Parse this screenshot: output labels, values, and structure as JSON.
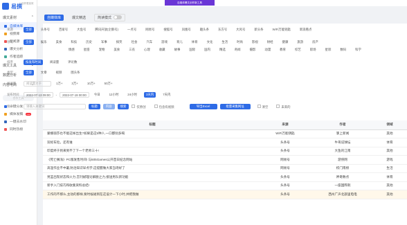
{
  "app": {
    "name": "易撰",
    "subtitle": "让创作更高效"
  },
  "top_ad": "自媒体爆文创作新工具",
  "sidebar": {
    "sections": [
      {
        "label": "爆文素材",
        "items": [
          "自媒体库",
          "视频库",
          "新闻源",
          "爆文分析",
          "作者追踪"
        ]
      },
      {
        "label": "爆文工具",
        "items": [
          "数据分析"
        ]
      },
      {
        "label": "内容电商",
        "items": []
      }
    ],
    "group": "合作工具",
    "tools": [
      "一键分发",
      "媒体发稿",
      "一键去水印",
      "同时热榜"
    ],
    "new_badge": "new"
  },
  "tabs": [
    "自媒体库",
    "爆文精选",
    "简读模式"
  ],
  "filters": {
    "source": {
      "label": "来源",
      "items": [
        "全部",
        "头条号",
        "百家号",
        "大鱼号",
        "腾讯开放(企鹅号)",
        "一点号",
        "网易号",
        "搜狐号",
        "凤凰号",
        "趣头条",
        "东方号",
        "大风号",
        "新头条",
        "WiFi万能钥匙",
        "新浪看点"
      ]
    },
    "field": {
      "label": "领域",
      "row1": [
        "全部",
        "娱乐",
        "美食",
        "科技",
        "历史",
        "军事",
        "搞笑",
        "社会",
        "汽车",
        "游戏",
        "育儿",
        "体育",
        "文化",
        "生活",
        "时尚",
        "影视",
        "财经",
        "健康",
        "旅游",
        "房产"
      ],
      "row2": [
        "情感",
        "星座",
        "宠物",
        "美食",
        "三农",
        "心理",
        "收藏",
        "故事",
        "国际",
        "国内",
        "精选",
        "奇闻",
        "摄影",
        "动漫",
        "教育",
        "综艺",
        "职场",
        "星际",
        "数码",
        "科学"
      ]
    },
    "sort": {
      "label": "排序",
      "items": [
        "按发布时间",
        "阅读量",
        "评论数"
      ]
    },
    "type": {
      "label": "类型",
      "items": [
        "全部",
        "文章",
        "视频",
        "图头条"
      ]
    },
    "read": {
      "label": "阅读量",
      "placeholder": "阅读量大于",
      "items": [
        "1万+",
        "3万+",
        "10万+",
        "50万+"
      ]
    },
    "time": {
      "label": "发布时间",
      "start": "2022-07-13 09:00",
      "end": "2022-07-19 00:00",
      "items": [
        "今日",
        "12小时",
        "24小时",
        "3天内",
        "7天内"
      ]
    },
    "search": {
      "label": "搜索",
      "placeholder": "请输入关键词",
      "btn_title": "标题",
      "btn_content": "内容",
      "btn_search": "搜索",
      "only_original": "仅原创",
      "exclude_video": "包含有视频",
      "export": "导出Excel",
      "batch": "批量采集网址",
      "clear": "清空",
      "word_cloud": "未来的"
    }
  },
  "table": {
    "headers": [
      "标题",
      "来源",
      "作者",
      "领域"
    ],
    "rows": [
      [
        "蒙娜丽莎也不能这样出生?如果是这5种人,一口都别多喝",
        "WiFi万能钥匙",
        "掌上新闻",
        "其他"
      ],
      [
        "双标车险，还有谁",
        "头条号",
        "牛哥说球坛",
        "体育"
      ],
      [
        "印度终于到来到不了下一个老师三十!",
        "头条号",
        "大鱼的江南",
        "其他"
      ],
      [
        "《死亡搁浅》PC版发售时间! 与505Games公开首日纪念网站",
        "网易号",
        "游侠网",
        "游戏"
      ],
      [
        "高温作业不中暑,防治知识早点学,这提醒做大家当场好了",
        "网易号",
        "校门南榜",
        "生活"
      ],
      [
        "男篮出现状态和火力,宫刊斌理论解脱之力,接送男队新功能",
        "头条号",
        "神奇数点",
        "体育"
      ],
      [
        "新手入门技巧和收集资料总结!",
        "头条号",
        "一座国際刺",
        "其他"
      ],
      [
        "工作的不那么,主动的那样,要时候碰到在这设计一下小时,并把我做",
        "头条号",
        "西州广声北部里电电",
        "其他"
      ]
    ]
  },
  "colors": {
    "accent": "#2e6be6",
    "ad": "#6a36d6"
  }
}
